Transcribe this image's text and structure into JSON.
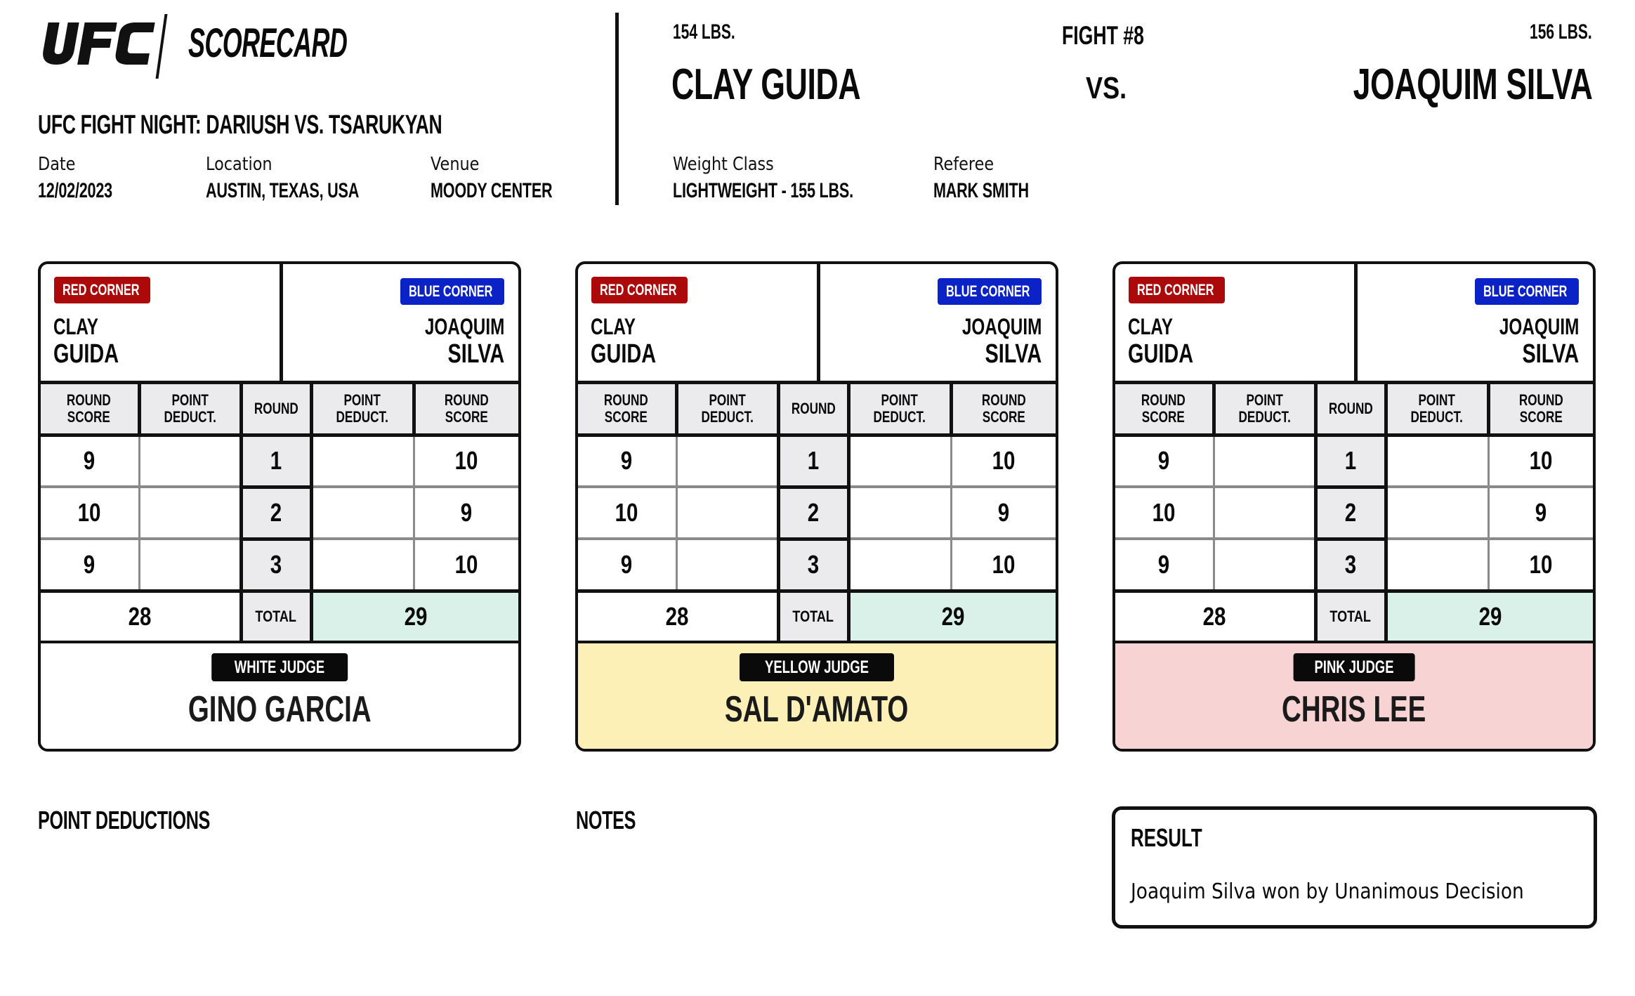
{
  "header": {
    "brand": "UFC",
    "document_title": "SCORECARD",
    "event_title": "UFC FIGHT NIGHT: DARIUSH VS. TSARUKYAN",
    "date_label": "Date",
    "date_value": "12/02/2023",
    "location_label": "Location",
    "location_value": "AUSTIN, TEXAS, USA",
    "venue_label": "Venue",
    "venue_value": "MOODY CENTER"
  },
  "bout": {
    "fight_number": "FIGHT #8",
    "vs": "VS.",
    "red": {
      "weight": "154 LBS.",
      "full_name": "CLAY GUIDA",
      "first_name": "CLAY",
      "last_name": "GUIDA"
    },
    "blue": {
      "weight": "156 LBS.",
      "full_name": "JOAQUIM SILVA",
      "first_name": "JOAQUIM",
      "last_name": "SILVA"
    },
    "weight_class_label": "Weight Class",
    "weight_class_value": "LIGHTWEIGHT - 155 LBS.",
    "referee_label": "Referee",
    "referee_value": "MARK SMITH"
  },
  "labels": {
    "red_corner": "RED CORNER",
    "blue_corner": "BLUE CORNER",
    "round_score": "ROUND\nSCORE",
    "point_deduct": "POINT\nDEDUCT.",
    "round": "ROUND",
    "total": "TOTAL"
  },
  "colors": {
    "red_corner": "#ac0a0a",
    "blue_corner": "#0b22c7",
    "header_gray": "#ebebed",
    "winner_total": "#d9f1e8",
    "white_judge": "#ffffff",
    "yellow_judge": "#fcf0b7",
    "pink_judge": "#f8d3d3"
  },
  "judges": [
    {
      "badge": "WHITE JUDGE",
      "name": "GINO GARCIA",
      "rounds": [
        {
          "round": "1",
          "red_score": "9",
          "red_deduct": "",
          "blue_deduct": "",
          "blue_score": "10"
        },
        {
          "round": "2",
          "red_score": "10",
          "red_deduct": "",
          "blue_deduct": "",
          "blue_score": "9"
        },
        {
          "round": "3",
          "red_score": "9",
          "red_deduct": "",
          "blue_deduct": "",
          "blue_score": "10"
        }
      ],
      "red_total": "28",
      "blue_total": "29"
    },
    {
      "badge": "YELLOW JUDGE",
      "name": "SAL D'AMATO",
      "rounds": [
        {
          "round": "1",
          "red_score": "9",
          "red_deduct": "",
          "blue_deduct": "",
          "blue_score": "10"
        },
        {
          "round": "2",
          "red_score": "10",
          "red_deduct": "",
          "blue_deduct": "",
          "blue_score": "9"
        },
        {
          "round": "3",
          "red_score": "9",
          "red_deduct": "",
          "blue_deduct": "",
          "blue_score": "10"
        }
      ],
      "red_total": "28",
      "blue_total": "29"
    },
    {
      "badge": "PINK JUDGE",
      "name": "CHRIS LEE",
      "rounds": [
        {
          "round": "1",
          "red_score": "9",
          "red_deduct": "",
          "blue_deduct": "",
          "blue_score": "10"
        },
        {
          "round": "2",
          "red_score": "10",
          "red_deduct": "",
          "blue_deduct": "",
          "blue_score": "9"
        },
        {
          "round": "3",
          "red_score": "9",
          "red_deduct": "",
          "blue_deduct": "",
          "blue_score": "10"
        }
      ],
      "red_total": "28",
      "blue_total": "29"
    }
  ],
  "footer": {
    "point_deductions_heading": "POINT DEDUCTIONS",
    "notes_heading": "NOTES",
    "result_heading": "RESULT",
    "result_text": "Joaquim Silva won by Unanimous Decision"
  }
}
